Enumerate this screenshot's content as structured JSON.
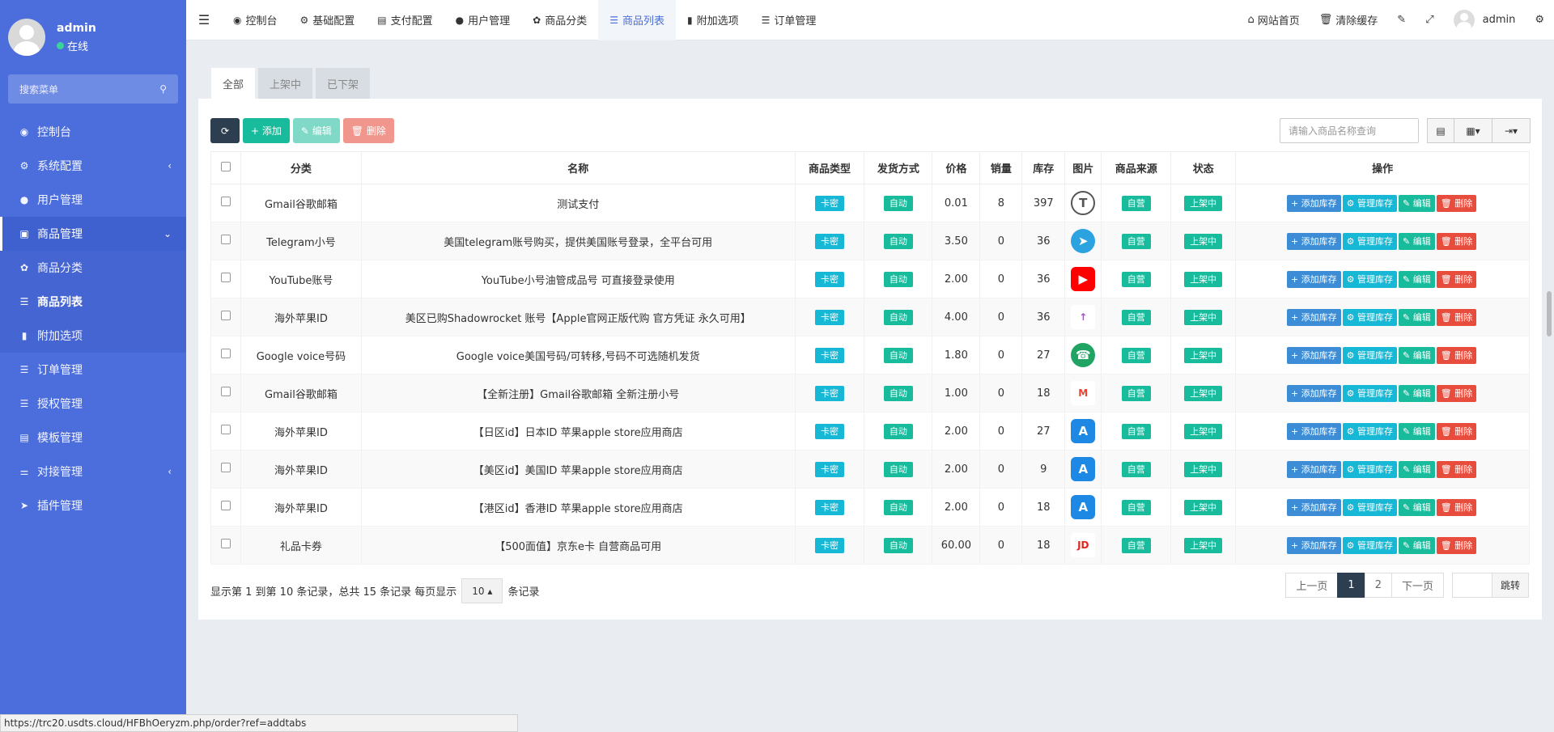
{
  "sidebar": {
    "user": {
      "name": "admin",
      "status": "在线"
    },
    "search_placeholder": "搜索菜单",
    "items": [
      {
        "label": "控制台"
      },
      {
        "label": "系统配置"
      },
      {
        "label": "用户管理"
      },
      {
        "label": "商品管理"
      },
      {
        "label": "商品分类"
      },
      {
        "label": "商品列表"
      },
      {
        "label": "附加选项"
      },
      {
        "label": "订单管理"
      },
      {
        "label": "授权管理"
      },
      {
        "label": "模板管理"
      },
      {
        "label": "对接管理"
      },
      {
        "label": "插件管理"
      }
    ]
  },
  "topbar": {
    "tabs": [
      "控制台",
      "基础配置",
      "支付配置",
      "用户管理",
      "商品分类",
      "商品列表",
      "附加选项",
      "订单管理"
    ],
    "right": {
      "home": "网站首页",
      "clear_cache": "清除缓存",
      "user": "admin"
    }
  },
  "filter_tabs": [
    "全部",
    "上架中",
    "已下架"
  ],
  "toolbar": {
    "add": "添加",
    "edit": "编辑",
    "delete": "删除",
    "search_placeholder": "请输入商品名称查询"
  },
  "table": {
    "headers": [
      "分类",
      "名称",
      "商品类型",
      "发货方式",
      "价格",
      "销量",
      "库存",
      "图片",
      "商品来源",
      "状态",
      "操作"
    ],
    "type_label": "卡密",
    "delivery_label": "自动",
    "source_label": "自营",
    "status_label": "上架中",
    "actions": {
      "add_stock": "添加库存",
      "manage_stock": "管理库存",
      "edit": "编辑",
      "delete": "删除"
    },
    "rows": [
      {
        "category": "Gmail谷歌邮箱",
        "name": "测试支付",
        "price": "0.01",
        "sales": "8",
        "stock": "397",
        "icon": "tether-icon",
        "color": "#50af95"
      },
      {
        "category": "Telegram小号",
        "name": "美国telegram账号购买，提供美国账号登录，全平台可用",
        "price": "3.50",
        "sales": "0",
        "stock": "36",
        "icon": "telegram-icon",
        "color": "#2aa3e0"
      },
      {
        "category": "YouTube账号",
        "name": "YouTube小号油管成品号 可直接登录使用",
        "price": "2.00",
        "sales": "0",
        "stock": "36",
        "icon": "youtube-icon",
        "color": "#ff0000"
      },
      {
        "category": "海外苹果ID",
        "name": "美区已购Shadowrocket 账号【Apple官网正版代购 官方凭证 永久可用】",
        "price": "4.00",
        "sales": "0",
        "stock": "36",
        "icon": "rocket-icon",
        "color": "#9b59b6"
      },
      {
        "category": "Google voice号码",
        "name": "Google voice美国号码/可转移,号码不可选随机发货",
        "price": "1.80",
        "sales": "0",
        "stock": "27",
        "icon": "phone-icon",
        "color": "#1fa463"
      },
      {
        "category": "Gmail谷歌邮箱",
        "name": "【全新注册】Gmail谷歌邮箱 全新注册小号",
        "price": "1.00",
        "sales": "0",
        "stock": "18",
        "icon": "gmail-icon",
        "color": "#ea4335"
      },
      {
        "category": "海外苹果ID",
        "name": "【日区id】日本ID 苹果apple store应用商店",
        "price": "2.00",
        "sales": "0",
        "stock": "27",
        "icon": "app-store-icon",
        "color": "#1e88e5"
      },
      {
        "category": "海外苹果ID",
        "name": "【美区id】美国ID 苹果apple store应用商店",
        "price": "2.00",
        "sales": "0",
        "stock": "9",
        "icon": "app-store-icon",
        "color": "#1e88e5"
      },
      {
        "category": "海外苹果ID",
        "name": "【港区id】香港ID 苹果apple store应用商店",
        "price": "2.00",
        "sales": "0",
        "stock": "18",
        "icon": "app-store-icon",
        "color": "#1e88e5"
      },
      {
        "category": "礼品卡券",
        "name": "【500面值】京东e卡 自营商品可用",
        "price": "60.00",
        "sales": "0",
        "stock": "18",
        "icon": "jd-icon",
        "color": "#e1251b"
      }
    ]
  },
  "footer": {
    "info_prefix": "显示第 1 到第 10 条记录，总共 15 条记录 每页显示",
    "per_page": "10",
    "info_suffix": "条记录",
    "prev": "上一页",
    "pages": [
      "1",
      "2"
    ],
    "next": "下一页",
    "go": "跳转"
  },
  "statusbar": "https://trc20.usdts.cloud/HFBhOeryzm.php/order?ref=addtabs"
}
